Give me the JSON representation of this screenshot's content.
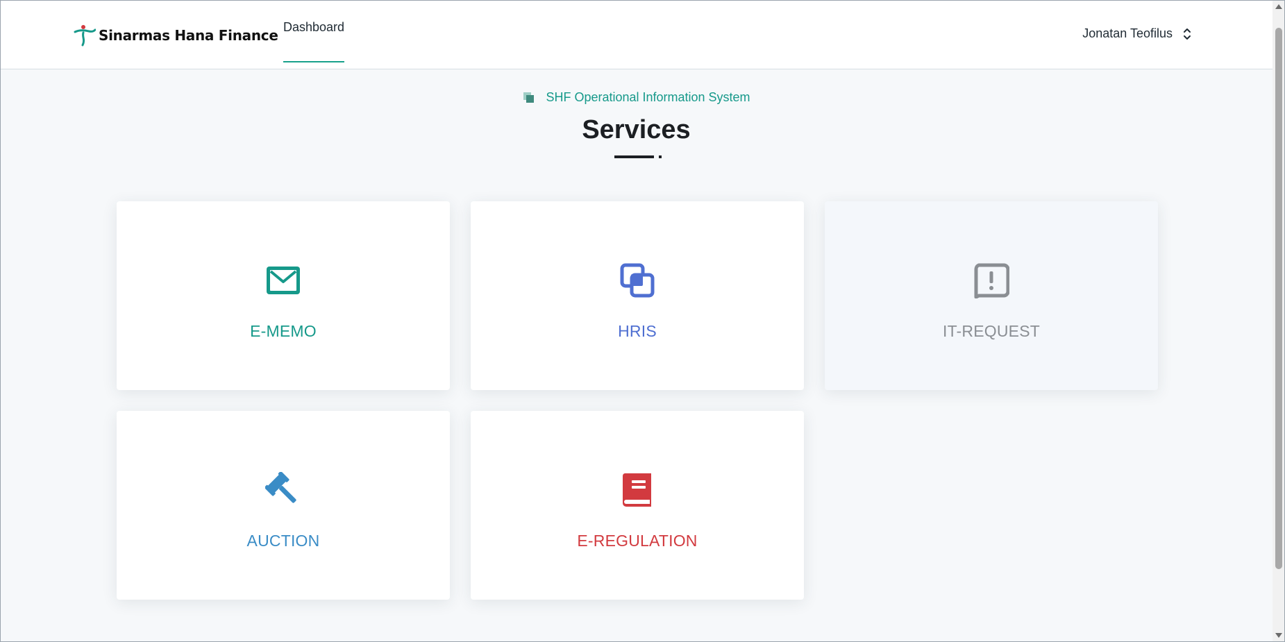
{
  "header": {
    "brand_name": "Sinarmas Hana Finance",
    "brand_icon": "sinarmas-hana-finance-logo-icon",
    "nav_dashboard_label": "Dashboard",
    "user_name": "Jonatan Teofilus",
    "user_menu_icon": "chevron-up-down-icon",
    "accent_color": "#17a08b"
  },
  "page": {
    "eyebrow_icon": "stack-squares-icon",
    "eyebrow_text": "SHF Operational Information System",
    "title": "Services"
  },
  "services": {
    "ememo": {
      "label": "E-MEMO",
      "icon": "envelope-icon",
      "color": "#16998a",
      "enabled": true
    },
    "hris": {
      "label": "HRIS",
      "icon": "overlapping-squares-icon",
      "color": "#4f6fd1",
      "enabled": true
    },
    "itrequest": {
      "label": "IT-REQUEST",
      "icon": "exclamation-bubble-icon",
      "color": "#8a8e93",
      "enabled": false
    },
    "auction": {
      "label": "AUCTION",
      "icon": "gavel-icon",
      "color": "#3a8cc6",
      "enabled": true
    },
    "eregulation": {
      "label": "E-REGULATION",
      "icon": "book-icon",
      "color": "#d23a3f",
      "enabled": true
    }
  }
}
